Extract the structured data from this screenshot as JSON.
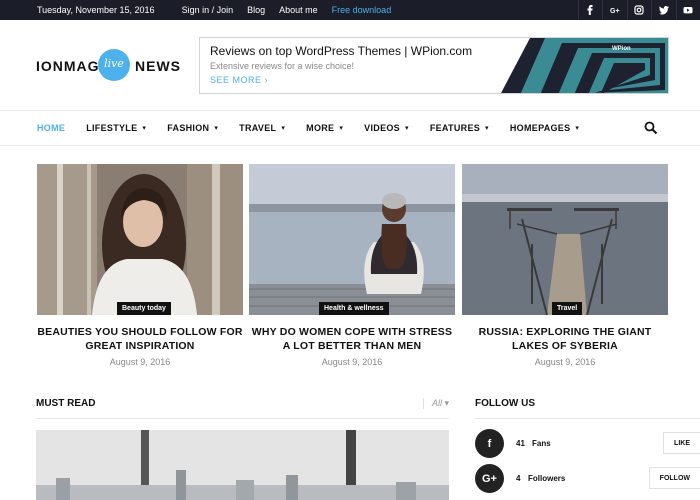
{
  "topbar": {
    "date": "Tuesday, November 15, 2016",
    "links": [
      {
        "label": "Sign in / Join"
      },
      {
        "label": "Blog"
      },
      {
        "label": "About me"
      },
      {
        "label": "Free download",
        "accent": "#4db2ec"
      }
    ],
    "socials": [
      "facebook-icon",
      "google-plus-icon",
      "instagram-icon",
      "twitter-icon",
      "youtube-icon"
    ]
  },
  "logo": {
    "word1": "IONMAG",
    "badge": "live",
    "word2": "NEWS",
    "color": "#4db2ec"
  },
  "banner": {
    "title": "Reviews on top WordPress Themes | WPion.com",
    "subtitle": "Extensive reviews for a wise choice!",
    "cta": "SEE MORE ›",
    "brand": "WPion"
  },
  "nav": {
    "items": [
      {
        "label": "HOME",
        "active": true
      },
      {
        "label": "LIFESTYLE",
        "caret": "▾"
      },
      {
        "label": "FASHION",
        "caret": "▾"
      },
      {
        "label": "TRAVEL",
        "caret": "▾"
      },
      {
        "label": "MORE",
        "caret": "▾"
      },
      {
        "label": "VIDEOS",
        "caret": "▾"
      },
      {
        "label": "FEATURES",
        "caret": "▾"
      },
      {
        "label": "HOMEPAGES",
        "caret": "▾"
      }
    ],
    "search_icon": "search-icon"
  },
  "featured": [
    {
      "category": "Beauty today",
      "title": "BEAUTIES YOU SHOULD FOLLOW FOR GREAT INSPIRATION",
      "date": "August 9, 2016"
    },
    {
      "category": "Health & wellness",
      "title": "WHY DO WOMEN COPE WITH STRESS A LOT BETTER THAN MEN",
      "date": "August 9, 2016"
    },
    {
      "category": "Travel",
      "title": "RUSSIA: EXPLORING THE GIANT LAKES OF SYBERIA",
      "date": "August 9, 2016"
    }
  ],
  "must_read": {
    "heading": "MUST READ",
    "filter": "All ▾"
  },
  "follow": {
    "heading": "FOLLOW US",
    "rows": [
      {
        "icon": "f",
        "count": "41",
        "label": "Fans",
        "button": "LIKE"
      },
      {
        "icon": "G+",
        "count": "4",
        "label": "Followers",
        "button": "FOLLOW"
      }
    ]
  }
}
